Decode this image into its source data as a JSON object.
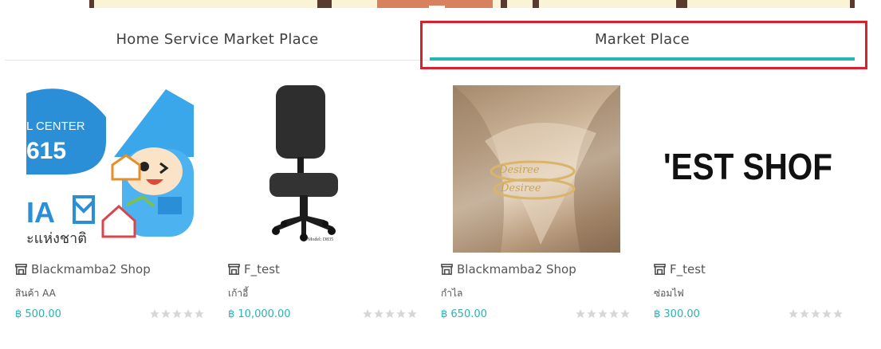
{
  "tabs": [
    {
      "label": "Home Service Market Place",
      "active": false
    },
    {
      "label": "Market Place",
      "active": true
    }
  ],
  "accent_color": "#25b7b1",
  "highlight_color": "#d8212c",
  "currency": "฿",
  "banner_text": {
    "center": "L CENTER",
    "number": "615",
    "brand": "IA",
    "thai": "ะแห่งชาติ"
  },
  "chair_model": "Model: D835",
  "ring_engraving": "Desiree",
  "test_shop_text": "'EST SHOF",
  "products": [
    {
      "shop": "Blackmamba2 Shop",
      "name": "สินค้า AA",
      "price": "฿ 500.00",
      "rating": 0,
      "image": "mascot-logo"
    },
    {
      "shop": "F_test",
      "name": "เก้าอี้",
      "price": "฿ 10,000.00",
      "rating": 0,
      "image": "office-chair"
    },
    {
      "shop": "Blackmamba2 Shop",
      "name": "กำไล",
      "price": "฿ 650.00",
      "rating": 0,
      "image": "name-ring"
    },
    {
      "shop": "F_test",
      "name": "ซ่อมไฟ",
      "price": "฿ 300.00",
      "rating": 0,
      "image": "test-shop-text"
    }
  ]
}
